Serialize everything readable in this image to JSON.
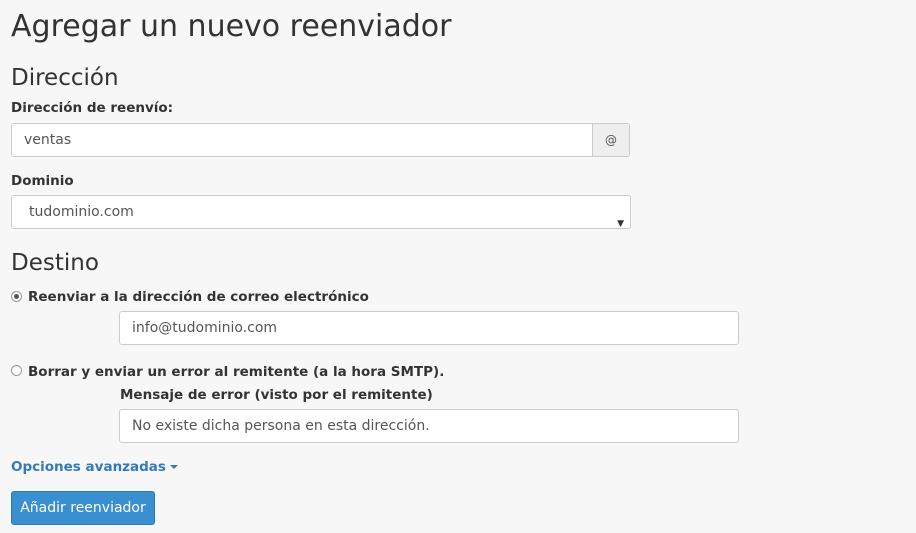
{
  "page": {
    "title": "Agregar un nuevo reenviador"
  },
  "address_section": {
    "title": "Dirección",
    "forward_label": "Dirección de reenvío:",
    "forward_value": "ventas",
    "at_symbol": "@",
    "domain_label": "Dominio",
    "domain_value": "tudominio.com"
  },
  "destination_section": {
    "title": "Destino",
    "option_forward": {
      "label": "Reenviar a la dirección de correo electrónico",
      "selected": true,
      "email_value": "info@tudominio.com"
    },
    "option_discard": {
      "label": "Borrar y enviar un error al remitente (a la hora SMTP).",
      "selected": false,
      "error_label": "Mensaje de error (visto por el remitente)",
      "error_value": "No existe dicha persona en esta dirección."
    }
  },
  "advanced": {
    "label": "Opciones avanzadas"
  },
  "submit": {
    "label": "Añadir reenviador"
  },
  "colors": {
    "accent": "#337ab7",
    "button": "#3a8fd1",
    "background": "#f7f7f7"
  }
}
